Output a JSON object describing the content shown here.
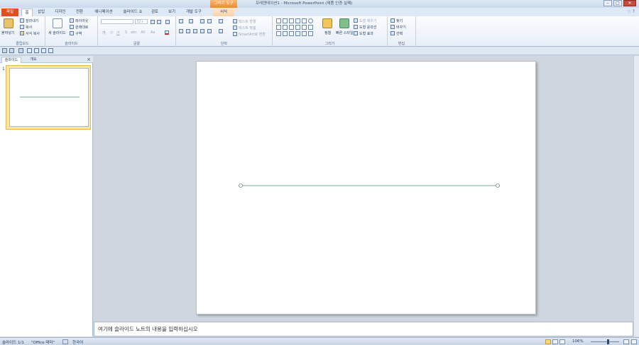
{
  "titlebar": {
    "context_tab": "그리기 도구",
    "title": "프레젠테이션1 - Microsoft PowerPoint (제품 인증 실패)",
    "minimize": "–",
    "maximize": "□",
    "close": "✕"
  },
  "tabs": {
    "file": "파일",
    "items": [
      "홈",
      "삽입",
      "디자인",
      "전환",
      "애니메이션",
      "슬라이드 쇼",
      "검토",
      "보기",
      "개발 도구",
      "서식"
    ],
    "active": "홈",
    "right_icons": "♢ ?"
  },
  "ribbon": {
    "clipboard": {
      "label": "클립보드",
      "paste": "붙여넣기",
      "cut": "잘라내기",
      "copy": "복사",
      "format_painter": "서식 복사"
    },
    "slides": {
      "label": "슬라이드",
      "new_slide": "새 슬라이드",
      "layout": "레이아웃",
      "reset": "원래대로",
      "section": "구역"
    },
    "font": {
      "label": "글꼴",
      "size_placeholder": "32+",
      "bold": "가",
      "italic": "가",
      "underline": "가",
      "strike": "S",
      "shadow": "abc",
      "spacing": "AV",
      "case": "Aa"
    },
    "paragraph": {
      "label": "단락",
      "text_direction": "텍스트 방향",
      "align_text": "텍스트 맞춤",
      "smartart": "SmartArt로 변환"
    },
    "drawing": {
      "label": "그리기",
      "arrange": "정렬",
      "quick_styles": "빠른 스타일",
      "shape_fill": "도형 채우기",
      "shape_outline": "도형 윤곽선",
      "shape_effects": "도형 효과"
    },
    "editing": {
      "label": "편집",
      "find": "찾기",
      "replace": "바꾸기",
      "select": "선택"
    }
  },
  "left_pane": {
    "tab_slides": "슬라이드",
    "tab_outline": "개요",
    "close": "×",
    "slide_number": "1"
  },
  "notes": {
    "placeholder": "여기에 슬라이드 노트의 내용을 입력하십시오"
  },
  "statusbar": {
    "slide_info": "슬라이드 1/1",
    "theme": "\"Office 테마\"",
    "language": "한국어",
    "zoom": "106%"
  },
  "colors": {
    "line": "#7fa99b",
    "accent": "#e14f1e",
    "ribbon_bg": "#f3f7fb"
  }
}
